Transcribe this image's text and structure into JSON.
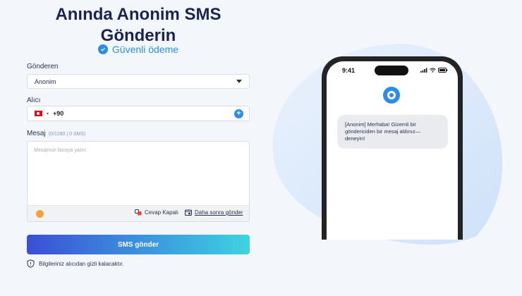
{
  "header": {
    "title_line1": "Anında Anonim SMS",
    "title_line2": "Gönderin",
    "secure_label": "Güvenli ödeme"
  },
  "form": {
    "sender_label": "Gönderen",
    "sender_value": "Anonim",
    "recipient_label": "Alıcı",
    "country_code": "+90",
    "message_label": "Mesaj",
    "message_counter": "(0/1280 | 0 SMS)",
    "message_placeholder": "Mesajınızı buraya yazın",
    "reply_option": "Cevap Kapalı",
    "schedule_option": "Daha sonra gönder",
    "send_button": "SMS gönder",
    "privacy_note": "Bilgileriniz alıcıdan gizli kalacaktır."
  },
  "preview": {
    "time": "9:41",
    "message": "[Anonim] Merhaba! Gizemli bir göndericiden bir mesaj aldınız—deneyin!"
  },
  "colors": {
    "accent": "#2b8de9",
    "title": "#1b2450",
    "button_start": "#3b4fd6",
    "button_end": "#3ed3e0"
  }
}
